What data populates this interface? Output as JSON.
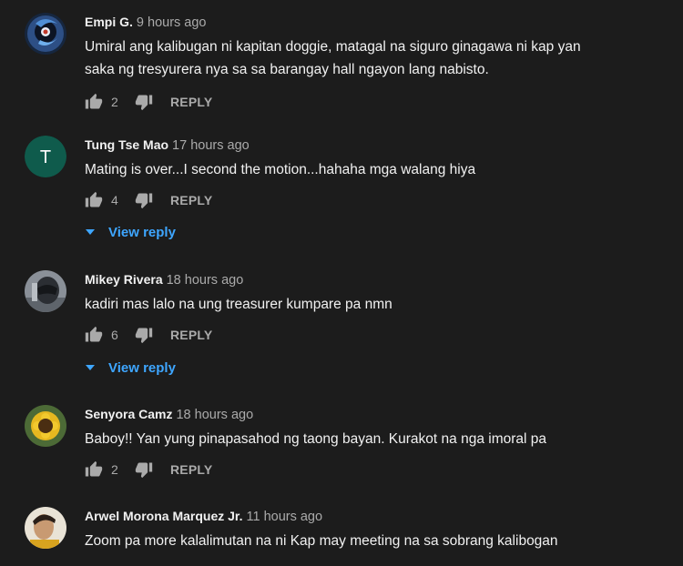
{
  "icons": {
    "like": "thumbs-up-icon",
    "dislike": "thumbs-down-icon",
    "expand": "caret-down-icon"
  },
  "colors": {
    "background": "#1c1c1c",
    "text": "#f1f1f1",
    "secondary": "#aaaaaa",
    "link": "#3ea6ff"
  },
  "comments": [
    {
      "author": "Empi G.",
      "time": "9 hours ago",
      "lines": [
        "Umiral ang kalibugan ni kapitan doggie, matagal na siguro ginagawa ni kap yan",
        "saka ng tresyurera nya sa sa barangay hall ngayon lang nabisto."
      ],
      "likes": "2",
      "reply_label": "REPLY"
    },
    {
      "author": "Tung Tse Mao",
      "time": "17 hours ago",
      "avatar_letter": "T",
      "lines": [
        "Mating is over...I second the motion...hahaha mga walang hiya"
      ],
      "likes": "4",
      "reply_label": "REPLY",
      "view_reply": "View reply"
    },
    {
      "author": "Mikey Rivera",
      "time": "18 hours ago",
      "lines": [
        "kadiri mas lalo na ung treasurer kumpare pa nmn"
      ],
      "likes": "6",
      "reply_label": "REPLY",
      "view_reply": "View reply"
    },
    {
      "author": "Senyora Camz",
      "time": "18 hours ago",
      "lines": [
        "Baboy!! Yan yung pinapasahod ng taong bayan. Kurakot na nga imoral pa"
      ],
      "likes": "2",
      "reply_label": "REPLY"
    },
    {
      "author": "Arwel Morona Marquez Jr.",
      "time": "11 hours ago",
      "lines": [
        "Zoom pa more kalalimutan na ni Kap may meeting na sa sobrang kalibogan"
      ]
    }
  ]
}
